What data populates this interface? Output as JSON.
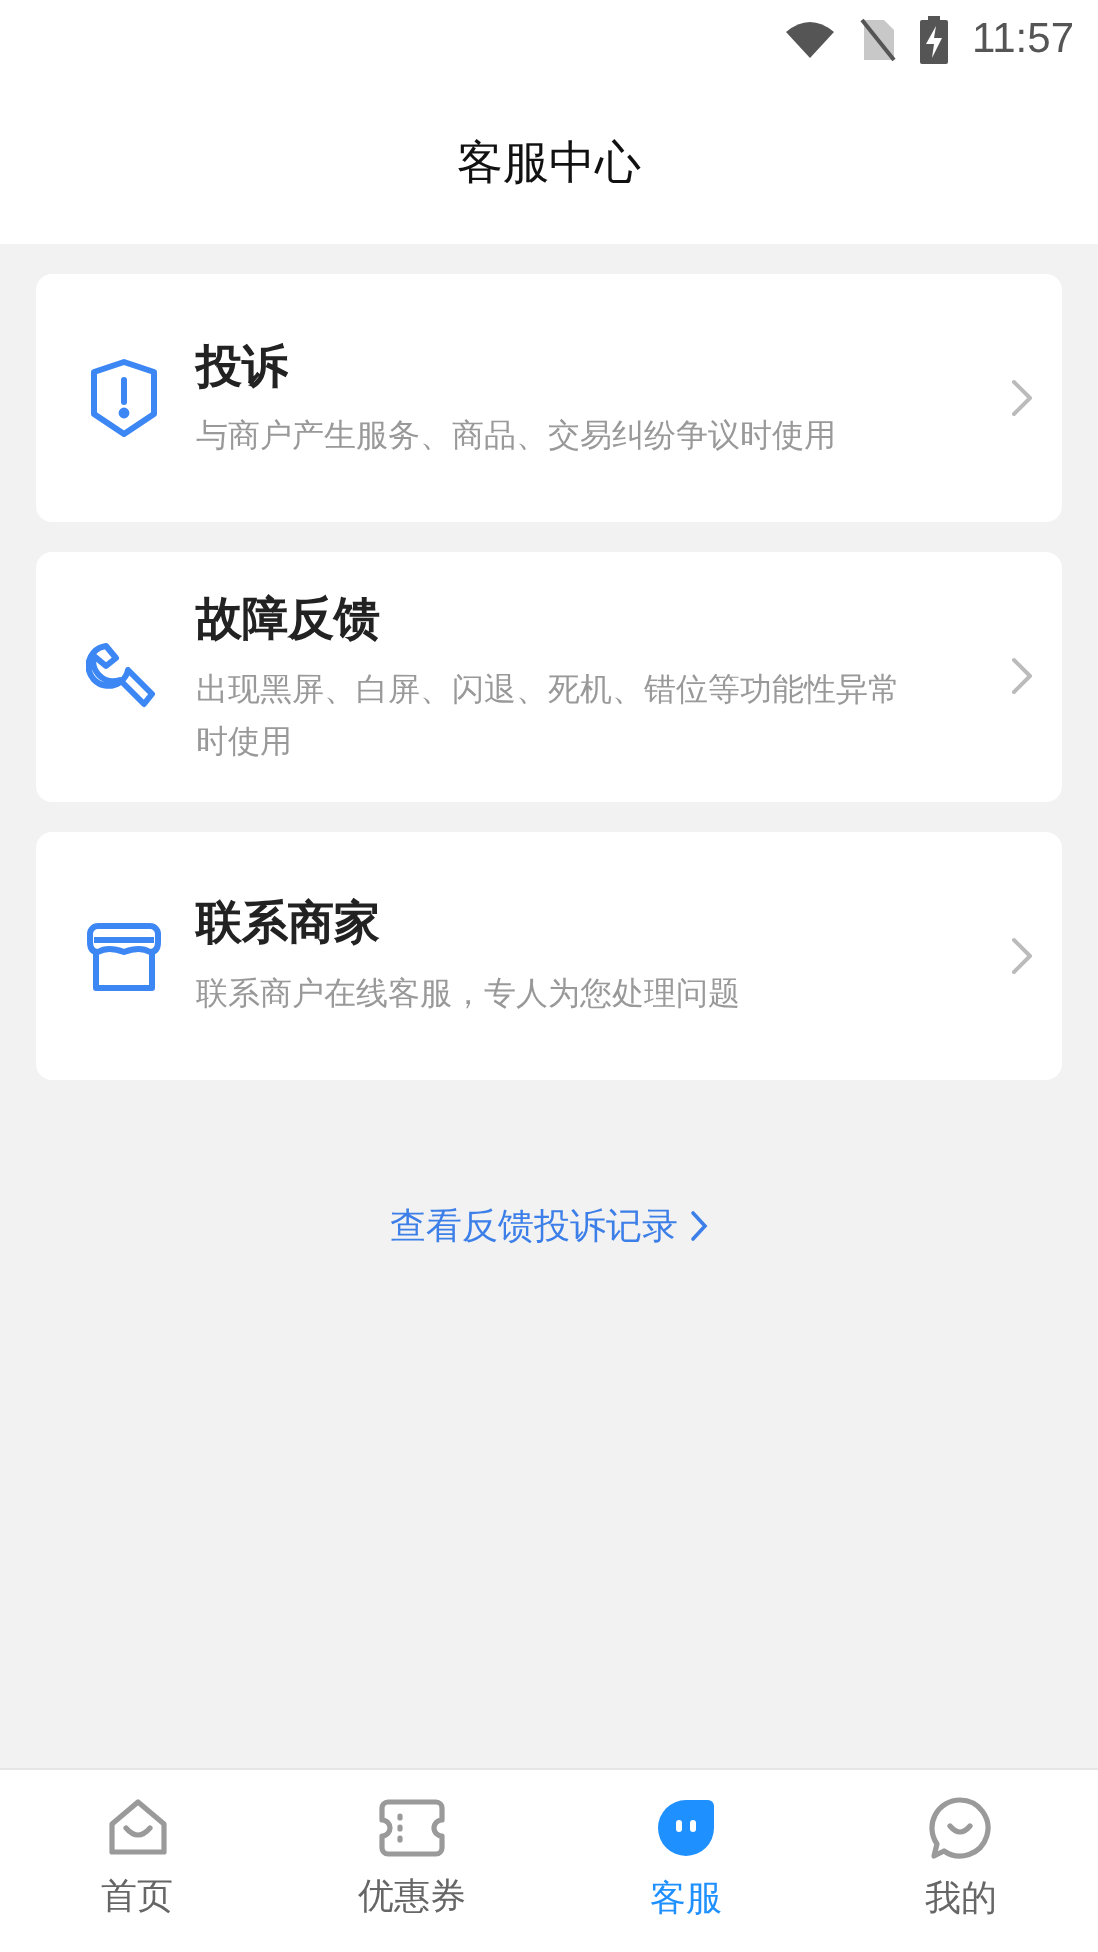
{
  "status_bar": {
    "time": "11:57"
  },
  "header": {
    "title": "客服中心"
  },
  "options": [
    {
      "kind": "shield",
      "title": "投诉",
      "description": "与商户产生服务、商品、交易纠纷争议时使用"
    },
    {
      "kind": "wrench",
      "title": "故障反馈",
      "description": "出现黑屏、白屏、闪退、死机、错位等功能性异常时使用"
    },
    {
      "kind": "store",
      "title": "联系商家",
      "description": "联系商户在线客服，专人为您处理问题"
    }
  ],
  "records_link": {
    "label": "查看反馈投诉记录"
  },
  "tab_bar": [
    {
      "kind": "home",
      "label": "首页",
      "selected": false
    },
    {
      "kind": "ticket",
      "label": "优惠券",
      "selected": false
    },
    {
      "kind": "service",
      "label": "客服",
      "selected": true
    },
    {
      "kind": "chat",
      "label": "我的",
      "selected": false
    }
  ]
}
